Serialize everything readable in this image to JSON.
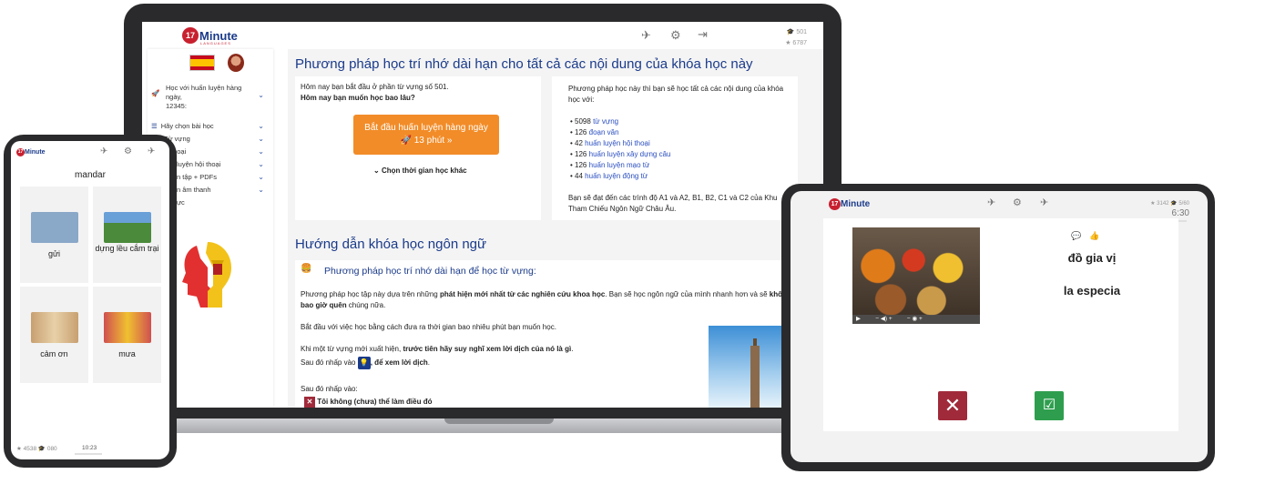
{
  "laptop": {
    "logo": {
      "number": "17",
      "word": "Minute",
      "sub": "LANGUAGES"
    },
    "stats": {
      "words": "501",
      "points": "6787"
    },
    "sidebar": {
      "items": [
        {
          "label_line1": "Học với huấn luyện hàng",
          "label_line2": "ngày,",
          "label_line3": "12345:"
        },
        {
          "label": "Hãy chọn bài học"
        },
        {
          "label": "Từ vựng"
        },
        {
          "label": "thoại"
        },
        {
          "label": "luyện hội thoại"
        },
        {
          "label": "n tập + PDFs"
        },
        {
          "label": "n âm thanh"
        },
        {
          "label": "ực"
        }
      ]
    },
    "main": {
      "title1": "Phương pháp học trí nhớ dài hạn cho tất cả các nội dung của khóa học này",
      "left_card": {
        "line1": "Hôm nay bạn bắt đầu ở phần từ vựng số 501.",
        "line2": "Hôm nay bạn muốn học bao lâu?",
        "button_line1": "Bắt đầu huấn luyện hàng ngày",
        "button_line2": "13 phút",
        "choose_time": "Chọn thời gian học khác"
      },
      "right_card": {
        "intro1": "Phương pháp học này thì bạn sẽ học tất cả các nội dung của khóa",
        "intro2": "học với:",
        "items": [
          {
            "count": "5098",
            "label": "từ vựng"
          },
          {
            "count": "126",
            "label": "đoạn văn"
          },
          {
            "count": "42",
            "label": "huấn luyện hội thoại"
          },
          {
            "count": "126",
            "label": "huấn luyện xây dựng câu"
          },
          {
            "count": "126",
            "label": "huấn luyện mạo từ"
          },
          {
            "count": "44",
            "label": "huấn luyện động từ"
          }
        ],
        "outro1": "Bạn sẽ đạt đến các trình độ A1 và A2, B1, B2, C1 và C2 của Khu",
        "outro2": "Tham Chiếu Ngôn Ngữ Châu Âu."
      },
      "title2": "Hướng dẫn khóa học ngôn ngữ",
      "guide": {
        "subtitle": "Phương pháp học trí nhớ dài hạn để học từ vựng:",
        "p1_a": "Phương pháp học tập này dựa trên những ",
        "p1_b": "phát hiện mới nhất từ các nghiên cứu khoa học",
        "p1_c": ". Bạn sẽ học ngôn ngữ của mình nhanh hơn và sẽ ",
        "p1_d": "khô",
        "p1_e": "bao giờ quên",
        "p1_f": " chúng nữa.",
        "p2": "Bắt đầu với việc học bằng cách đưa ra thời gian bao nhiêu phút bạn muốn học.",
        "p3_a": "Khi một từ vựng mới xuất hiện, ",
        "p3_b": "trước tiên hãy suy nghĩ xem lời dịch của nó là gì",
        "p3_c": ".",
        "p4_a": "Sau đó nhấp vào",
        "p4_b": ", để xem lời dịch",
        "p4_c": ".",
        "p5": "Sau đó nhấp vào:",
        "p6": "Tôi không (chưa) thể làm điều đó"
      }
    }
  },
  "phone": {
    "logo": {
      "number": "17",
      "word": "Minute"
    },
    "word": "mandar",
    "tiles": [
      {
        "label": "gửi",
        "color": "#8aa8c8"
      },
      {
        "label": "dựng lều cắm trại",
        "color": "#4a8a3a"
      },
      {
        "label": "cảm ơn",
        "color": "#c8a070"
      },
      {
        "label": "mưa",
        "color": "#d05050"
      }
    ],
    "footer": {
      "words": "4538",
      "points": "080",
      "time": "10:23"
    }
  },
  "tablet": {
    "logo": {
      "number": "17",
      "word": "Minute"
    },
    "stats": {
      "words": "3142",
      "points": "5/60"
    },
    "time": "6:30",
    "translation": "đồ gia vị",
    "word": "la especia"
  }
}
